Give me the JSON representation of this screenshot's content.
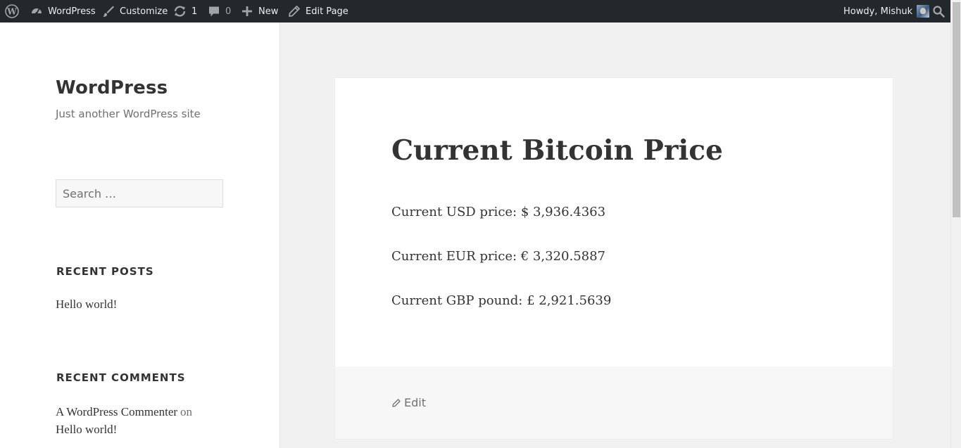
{
  "adminbar": {
    "wp_logo_icon": "wordpress-logo-icon",
    "site_name": "WordPress",
    "customize": "Customize",
    "updates_count": "1",
    "comments_count": "0",
    "new_label": "New",
    "edit_page": "Edit Page",
    "howdy": "Howdy, Mishuk",
    "bg_color": "#23282d"
  },
  "sidebar": {
    "site_title": "WordPress",
    "site_description": "Just another WordPress site",
    "search_placeholder": "Search …",
    "recent_posts_title": "RECENT POSTS",
    "recent_posts": [
      "Hello world!"
    ],
    "recent_comments_title": "RECENT COMMENTS",
    "recent_comment": {
      "author": "A WordPress Commenter",
      "connector": "on",
      "post": "Hello world!"
    }
  },
  "article": {
    "title": "Current Bitcoin Price",
    "prices": [
      "Current USD price: $ 3,936.4363",
      "Current EUR price: € 3,320.5887",
      "Current GBP pound: £ 2,921.5639"
    ],
    "edit_label": "Edit"
  }
}
